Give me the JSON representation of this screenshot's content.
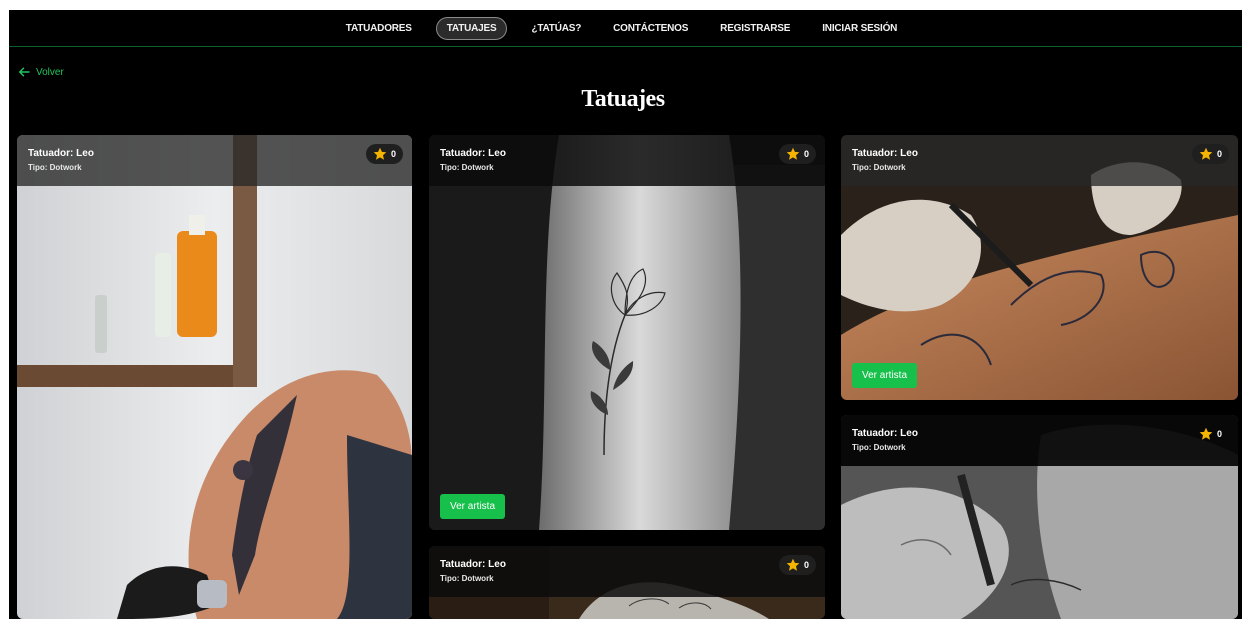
{
  "nav": {
    "items": [
      {
        "label": "TATUADORES",
        "active": false
      },
      {
        "label": "TATUAJES",
        "active": true
      },
      {
        "label": "¿TATÚAS?",
        "active": false
      },
      {
        "label": "CONTÁCTENOS",
        "active": false
      },
      {
        "label": "REGISTRARSE",
        "active": false
      },
      {
        "label": "INICIAR SESIÓN",
        "active": false
      }
    ]
  },
  "back": {
    "label": "Volver",
    "icon": "arrow-left-icon"
  },
  "page_title": "Tatuajes",
  "colors": {
    "accent": "#22c55e",
    "button": "#16c04a",
    "background": "#000000",
    "nav_border": "#0d5f2a",
    "star": "#f5b400"
  },
  "cards": [
    {
      "tattooist": "Tatuador: Leo",
      "type": "Tipo: Dotwork",
      "rating": "0",
      "button": "",
      "image": "arm-tattoo-photo"
    },
    {
      "tattooist": "Tatuador: Leo",
      "type": "Tipo: Dotwork",
      "rating": "0",
      "button": "Ver artista",
      "image": "flower-tattoo-photo"
    },
    {
      "tattooist": "Tatuador: Leo",
      "type": "Tipo: Dotwork",
      "rating": "0",
      "button": "Ver artista",
      "image": "tattooing-hands-photo"
    },
    {
      "tattooist": "Tatuador: Leo",
      "type": "Tipo: Dotwork",
      "rating": "0",
      "button": "",
      "image": "bw-tattooing-photo"
    },
    {
      "tattooist": "Tatuador: Leo",
      "type": "Tipo: Dotwork",
      "rating": "0",
      "button": "",
      "image": "sketch-tattoo-photo"
    }
  ]
}
